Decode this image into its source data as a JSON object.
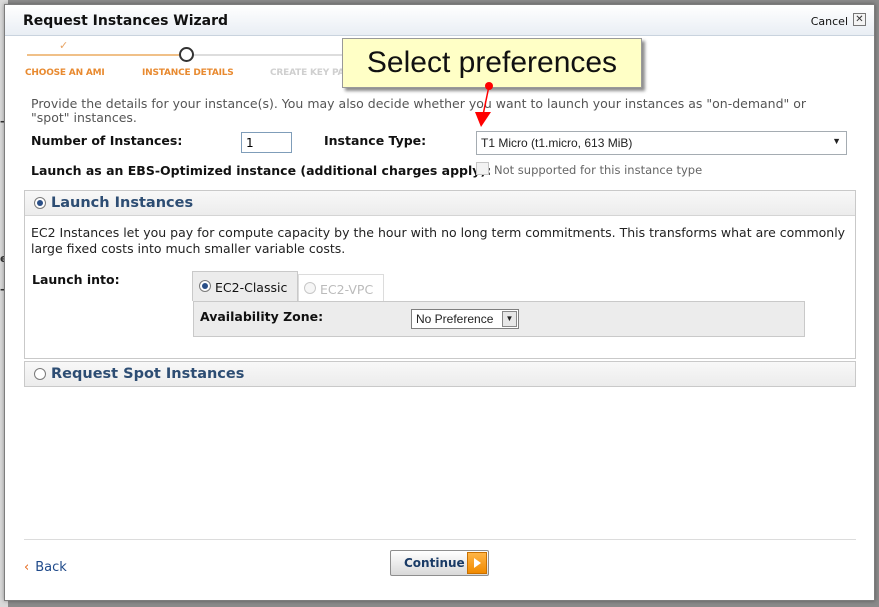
{
  "window": {
    "title": "Request Instances Wizard",
    "cancel_label": "Cancel",
    "close_glyph": "✕"
  },
  "steps": [
    {
      "label": "CHOOSE AN AMI",
      "state": "done",
      "mark": "✓"
    },
    {
      "label": "INSTANCE DETAILS",
      "state": "current"
    },
    {
      "label": "CREATE KEY PA",
      "state": "future"
    }
  ],
  "callout": {
    "text": "Select preferences",
    "color": "#ffffc6",
    "arrow_color": "#ff0000"
  },
  "description": "Provide the details for your instance(s). You may also decide whether you want to launch your instances as \"on-demand\" or \"spot\" instances.",
  "form": {
    "num_instances_label": "Number of Instances:",
    "num_instances_value": "1",
    "instance_type_label": "Instance Type:",
    "instance_type_value": "T1 Micro (t1.micro, 613 MiB)",
    "ebs_label": "Launch as an EBS-Optimized instance (additional charges apply):",
    "ebs_note": "Not supported for this instance type"
  },
  "launch_panel": {
    "title": "Launch Instances",
    "selected": true,
    "body": "EC2 Instances let you pay for compute capacity by the hour with no long term commitments. This transforms what are commonly large fixed costs into much smaller variable costs.",
    "launch_into_label": "Launch into:",
    "tabs": [
      {
        "label": "EC2-Classic",
        "selected": true
      },
      {
        "label": "EC2-VPC",
        "selected": false,
        "disabled": true
      }
    ],
    "az_label": "Availability Zone:",
    "az_value": "No Preference"
  },
  "spot_panel": {
    "title": "Request Spot Instances",
    "selected": false
  },
  "footer": {
    "back_label": "Back",
    "back_glyph": "‹",
    "continue_label": "Continue"
  },
  "colors": {
    "accent_orange": "#e88a30",
    "link_blue": "#1f4a8a",
    "panel_title": "#2d4d73"
  }
}
